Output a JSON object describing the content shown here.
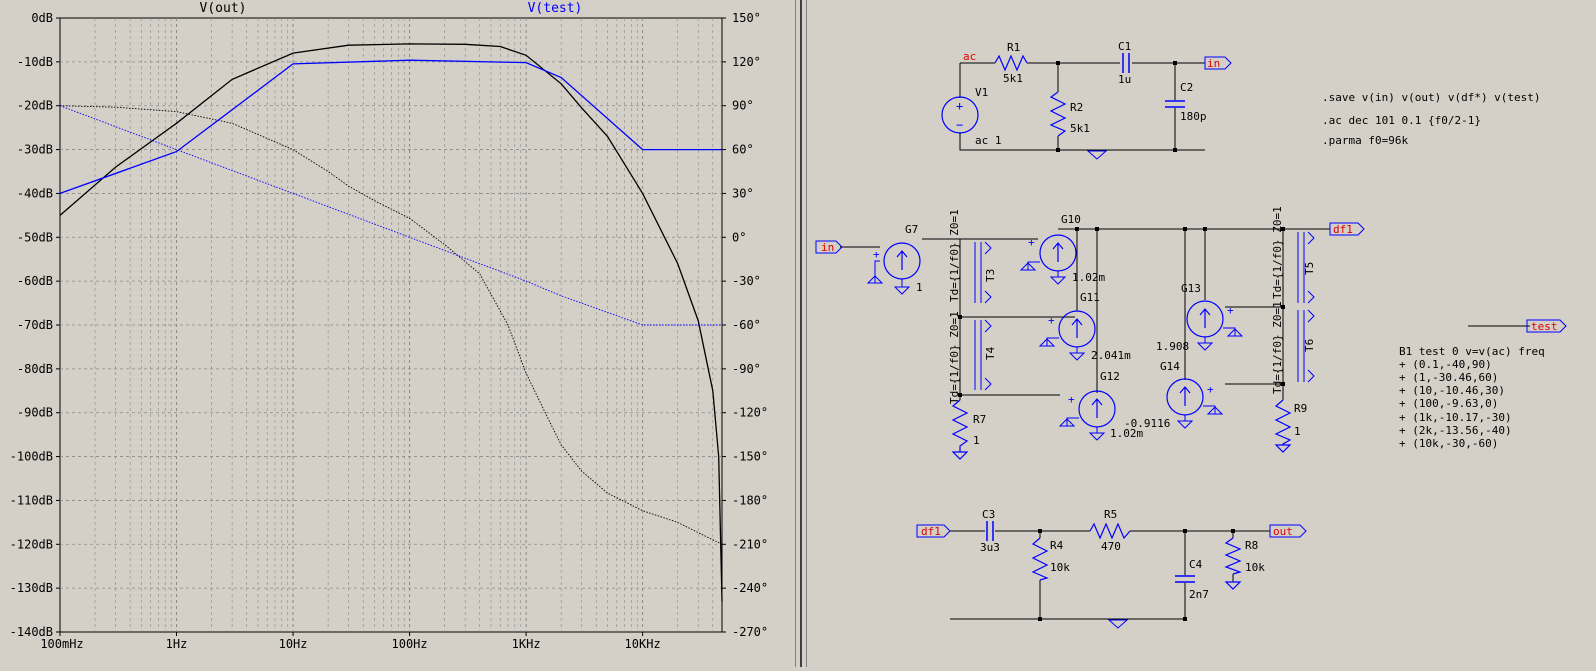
{
  "plot": {
    "traces": [
      {
        "name": "V(out)",
        "color": "#000000"
      },
      {
        "name": "V(test)",
        "color": "#0000ff"
      }
    ],
    "left_axis_labels": [
      "0dB",
      "-10dB",
      "-20dB",
      "-30dB",
      "-40dB",
      "-50dB",
      "-60dB",
      "-70dB",
      "-80dB",
      "-90dB",
      "-100dB",
      "-110dB",
      "-120dB",
      "-130dB",
      "-140dB"
    ],
    "right_axis_labels": [
      "150°",
      "120°",
      "90°",
      "60°",
      "30°",
      "0°",
      "-30°",
      "-60°",
      "-90°",
      "-120°",
      "-150°",
      "-180°",
      "-210°",
      "-240°",
      "-270°"
    ],
    "x_axis_labels": [
      "100mHz",
      "1Hz",
      "10Hz",
      "100Hz",
      "1KHz",
      "10KHz"
    ]
  },
  "chart_data": {
    "type": "line",
    "xscale": "log",
    "xlim": [
      0.1,
      48000
    ],
    "ylim": [
      -140,
      0
    ],
    "ylim_right": [
      -270,
      150
    ],
    "xlabel": "",
    "ylabel": "",
    "grid": true,
    "series": [
      {
        "name": "V(out)",
        "kind": "magnitude_dB",
        "axis": "left",
        "color": "#000000",
        "x": [
          0.1,
          0.3,
          1,
          3,
          10,
          30,
          100,
          300,
          600,
          1000,
          2000,
          3000,
          5000,
          10000,
          20000,
          30000,
          40000,
          45000,
          48000
        ],
        "y": [
          -45,
          -34,
          -24,
          -14,
          -8,
          -6.2,
          -5.9,
          -6,
          -6.5,
          -8.5,
          -15,
          -20.5,
          -27,
          -40,
          -56,
          -69,
          -85,
          -100,
          -133
        ]
      },
      {
        "name": "V(out)",
        "kind": "phase_deg",
        "axis": "right",
        "color": "#000000",
        "x": [
          0.1,
          0.3,
          1,
          3,
          10,
          20,
          30,
          50,
          100,
          200,
          400,
          700,
          1000,
          1500,
          2000,
          3000,
          5000,
          10000,
          20000,
          30000,
          48000
        ],
        "y": [
          90,
          89,
          86,
          78,
          60,
          45,
          35,
          25,
          13,
          -5,
          -25,
          -60,
          -93,
          -122,
          -142,
          -160,
          -175,
          -187,
          -195,
          -202,
          -210
        ]
      },
      {
        "name": "V(test)",
        "kind": "magnitude_dB",
        "axis": "left",
        "color": "#0000ff",
        "x": [
          0.1,
          1,
          10,
          100,
          1000,
          2000,
          10000,
          48000
        ],
        "y": [
          -40,
          -30.46,
          -10.46,
          -9.63,
          -10.17,
          -13.56,
          -30,
          -30
        ]
      },
      {
        "name": "V(test)",
        "kind": "phase_deg",
        "axis": "right",
        "color": "#0000ff",
        "x": [
          0.1,
          1,
          10,
          100,
          1000,
          2000,
          10000,
          48000
        ],
        "y": [
          90,
          60,
          30,
          0,
          -30,
          -40,
          -60,
          -60
        ]
      }
    ]
  },
  "schematic": {
    "directives": [
      ".save v(in) v(out) v(df*) v(test)",
      ".ac dec 101 0.1 {f0/2-1}",
      ".parma f0=96k"
    ],
    "behavioral": {
      "line0": "B1 test 0 v=v(ac) freq",
      "lines": [
        "+ (0.1,-40,90)",
        "+ (1,-30.46,60)",
        "+ (10,-10.46,30)",
        "+ (100,-9.63,0)",
        "+ (1k,-10.17,-30)",
        "+ (2k,-13.56,-40)",
        "+ (10k,-30,-60)"
      ]
    },
    "nets": {
      "ac": "ac",
      "in": "in",
      "df1": "df1",
      "test": "test",
      "out": "out"
    },
    "components": {
      "R1": {
        "name": "R1",
        "value": "5k1"
      },
      "R2": {
        "name": "R2",
        "value": "5k1"
      },
      "C1": {
        "name": "C1",
        "value": "1u"
      },
      "C2": {
        "name": "C2",
        "value": "180p"
      },
      "V1": {
        "name": "V1",
        "value": "ac 1"
      },
      "G7": {
        "name": "G7",
        "value": "1"
      },
      "G10": {
        "name": "G10",
        "value": "1.02m"
      },
      "G11": {
        "name": "G11",
        "value": "2.041m"
      },
      "G12": {
        "name": "G12",
        "value": "1.02m"
      },
      "G13": {
        "name": "G13",
        "value": "1.908"
      },
      "G14": {
        "name": "G14",
        "value": "-0.9116"
      },
      "T3": {
        "name": "T3",
        "value": "Td={1/f0} Z0=1"
      },
      "T4": {
        "name": "T4",
        "value": "Td={1/f0} Z0=1"
      },
      "T5": {
        "name": "T5",
        "value": "Td={1/f0} Z0=1"
      },
      "T6": {
        "name": "T6",
        "value": "Td={1/f0} Z0=1"
      },
      "R7": {
        "name": "R7",
        "value": "1"
      },
      "R9": {
        "name": "R9",
        "value": "1"
      },
      "C3": {
        "name": "C3",
        "value": "3u3"
      },
      "R4": {
        "name": "R4",
        "value": "10k"
      },
      "R5": {
        "name": "R5",
        "value": "470"
      },
      "C4": {
        "name": "C4",
        "value": "2n7"
      },
      "R8": {
        "name": "R8",
        "value": "10k"
      }
    }
  }
}
